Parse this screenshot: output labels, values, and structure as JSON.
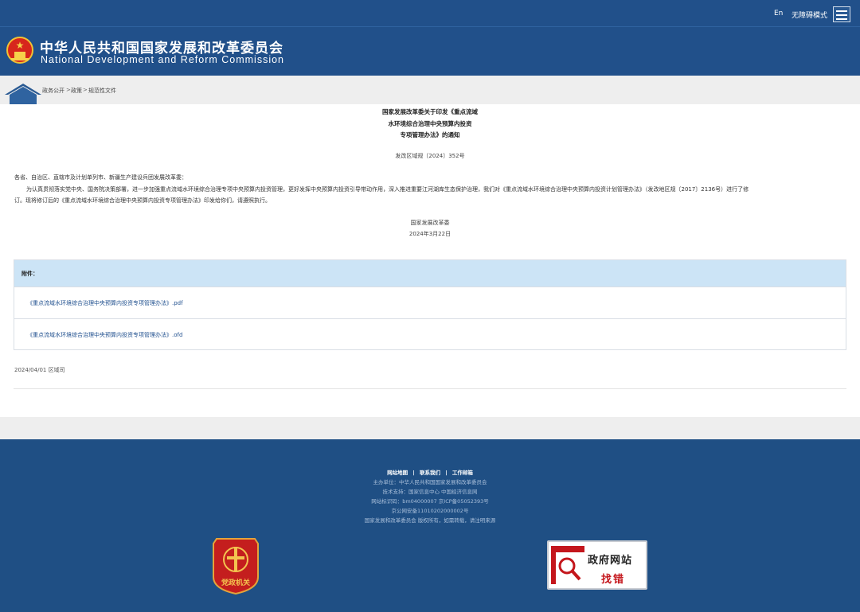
{
  "topbar": {
    "english_link": "En",
    "accessible_link": "无障碍模式"
  },
  "header": {
    "title_cn": "中华人民共和国国家发展和改革委员会",
    "title_en": "National Development and Reform Commission"
  },
  "breadcrumb": {
    "items": [
      "政务公开",
      "政策",
      "规范性文件"
    ],
    "separator": ">"
  },
  "article": {
    "title_lines": [
      "国家发展改革委关于印发《重点流域",
      "水环境综合治理中央预算内投资",
      "专项管理办法》的通知"
    ],
    "doc_number": "发改区域规〔2024〕352号",
    "salutation": "各省、自治区、直辖市及计划单列市、新疆生产建设兵团发展改革委：",
    "body_line1": "为认真贯彻落实党中央、国务院决策部署，进一步加强重点流域水环境综合治理专项中央预算内投资管理，更好发挥中央预算内投资引导带动作用，深入推进重要江河湖库生态保护治理，我们对《重点流域水环境综合治理中央预算内投资计划管理办法》（发改地区规〔2017〕2136号）进行了修",
    "body_line2": "订。现将修订后的《重点流域水环境综合治理中央预算内投资专项管理办法》印发给你们，请遵照执行。",
    "sign_org": "国家发展改革委",
    "sign_date": "2024年3月22日"
  },
  "attachments": {
    "header": "附件：",
    "files": [
      "《重点流域水环境综合治理中央预算内投资专项管理办法》.pdf",
      "《重点流域水环境综合治理中央预算内投资专项管理办法》.ofd"
    ]
  },
  "pub_info": "2024/04/01 区域司",
  "footer": {
    "links": [
      "网站地图",
      "联系我们",
      "工作邮箱"
    ],
    "link_separator": "|",
    "host": "主办单位：中华人民共和国国家发展和改革委员会",
    "tech": "技术支持：国家信息中心 中国经济信息网",
    "icp": "网站标识码：bm04000007 京ICP备05052393号",
    "police": "京公网安备11010202000002号",
    "copyright": "国家发展和改革委员会 版权所有，如需转载，请注明来源"
  },
  "badges": {
    "party_badge_text": "党政机关",
    "gov_badge_line1": "政府网站",
    "gov_badge_line2": "找错"
  },
  "colors": {
    "header_blue": "#21508a",
    "footer_blue": "#1f4f84",
    "attach_header": "#cce4f6",
    "link_blue": "#1f4f8e",
    "badge_red": "#c4161c"
  }
}
